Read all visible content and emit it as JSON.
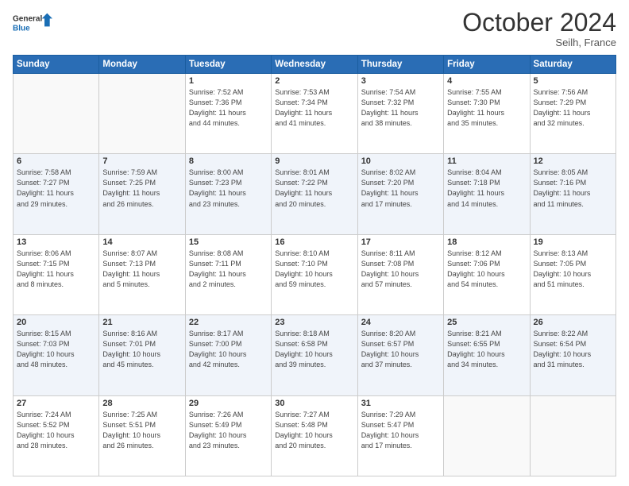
{
  "logo": {
    "line1": "General",
    "line2": "Blue"
  },
  "title": "October 2024",
  "location": "Seilh, France",
  "days_header": [
    "Sunday",
    "Monday",
    "Tuesday",
    "Wednesday",
    "Thursday",
    "Friday",
    "Saturday"
  ],
  "weeks": [
    [
      {
        "day": "",
        "info": ""
      },
      {
        "day": "",
        "info": ""
      },
      {
        "day": "1",
        "info": "Sunrise: 7:52 AM\nSunset: 7:36 PM\nDaylight: 11 hours\nand 44 minutes."
      },
      {
        "day": "2",
        "info": "Sunrise: 7:53 AM\nSunset: 7:34 PM\nDaylight: 11 hours\nand 41 minutes."
      },
      {
        "day": "3",
        "info": "Sunrise: 7:54 AM\nSunset: 7:32 PM\nDaylight: 11 hours\nand 38 minutes."
      },
      {
        "day": "4",
        "info": "Sunrise: 7:55 AM\nSunset: 7:30 PM\nDaylight: 11 hours\nand 35 minutes."
      },
      {
        "day": "5",
        "info": "Sunrise: 7:56 AM\nSunset: 7:29 PM\nDaylight: 11 hours\nand 32 minutes."
      }
    ],
    [
      {
        "day": "6",
        "info": "Sunrise: 7:58 AM\nSunset: 7:27 PM\nDaylight: 11 hours\nand 29 minutes."
      },
      {
        "day": "7",
        "info": "Sunrise: 7:59 AM\nSunset: 7:25 PM\nDaylight: 11 hours\nand 26 minutes."
      },
      {
        "day": "8",
        "info": "Sunrise: 8:00 AM\nSunset: 7:23 PM\nDaylight: 11 hours\nand 23 minutes."
      },
      {
        "day": "9",
        "info": "Sunrise: 8:01 AM\nSunset: 7:22 PM\nDaylight: 11 hours\nand 20 minutes."
      },
      {
        "day": "10",
        "info": "Sunrise: 8:02 AM\nSunset: 7:20 PM\nDaylight: 11 hours\nand 17 minutes."
      },
      {
        "day": "11",
        "info": "Sunrise: 8:04 AM\nSunset: 7:18 PM\nDaylight: 11 hours\nand 14 minutes."
      },
      {
        "day": "12",
        "info": "Sunrise: 8:05 AM\nSunset: 7:16 PM\nDaylight: 11 hours\nand 11 minutes."
      }
    ],
    [
      {
        "day": "13",
        "info": "Sunrise: 8:06 AM\nSunset: 7:15 PM\nDaylight: 11 hours\nand 8 minutes."
      },
      {
        "day": "14",
        "info": "Sunrise: 8:07 AM\nSunset: 7:13 PM\nDaylight: 11 hours\nand 5 minutes."
      },
      {
        "day": "15",
        "info": "Sunrise: 8:08 AM\nSunset: 7:11 PM\nDaylight: 11 hours\nand 2 minutes."
      },
      {
        "day": "16",
        "info": "Sunrise: 8:10 AM\nSunset: 7:10 PM\nDaylight: 10 hours\nand 59 minutes."
      },
      {
        "day": "17",
        "info": "Sunrise: 8:11 AM\nSunset: 7:08 PM\nDaylight: 10 hours\nand 57 minutes."
      },
      {
        "day": "18",
        "info": "Sunrise: 8:12 AM\nSunset: 7:06 PM\nDaylight: 10 hours\nand 54 minutes."
      },
      {
        "day": "19",
        "info": "Sunrise: 8:13 AM\nSunset: 7:05 PM\nDaylight: 10 hours\nand 51 minutes."
      }
    ],
    [
      {
        "day": "20",
        "info": "Sunrise: 8:15 AM\nSunset: 7:03 PM\nDaylight: 10 hours\nand 48 minutes."
      },
      {
        "day": "21",
        "info": "Sunrise: 8:16 AM\nSunset: 7:01 PM\nDaylight: 10 hours\nand 45 minutes."
      },
      {
        "day": "22",
        "info": "Sunrise: 8:17 AM\nSunset: 7:00 PM\nDaylight: 10 hours\nand 42 minutes."
      },
      {
        "day": "23",
        "info": "Sunrise: 8:18 AM\nSunset: 6:58 PM\nDaylight: 10 hours\nand 39 minutes."
      },
      {
        "day": "24",
        "info": "Sunrise: 8:20 AM\nSunset: 6:57 PM\nDaylight: 10 hours\nand 37 minutes."
      },
      {
        "day": "25",
        "info": "Sunrise: 8:21 AM\nSunset: 6:55 PM\nDaylight: 10 hours\nand 34 minutes."
      },
      {
        "day": "26",
        "info": "Sunrise: 8:22 AM\nSunset: 6:54 PM\nDaylight: 10 hours\nand 31 minutes."
      }
    ],
    [
      {
        "day": "27",
        "info": "Sunrise: 7:24 AM\nSunset: 5:52 PM\nDaylight: 10 hours\nand 28 minutes."
      },
      {
        "day": "28",
        "info": "Sunrise: 7:25 AM\nSunset: 5:51 PM\nDaylight: 10 hours\nand 26 minutes."
      },
      {
        "day": "29",
        "info": "Sunrise: 7:26 AM\nSunset: 5:49 PM\nDaylight: 10 hours\nand 23 minutes."
      },
      {
        "day": "30",
        "info": "Sunrise: 7:27 AM\nSunset: 5:48 PM\nDaylight: 10 hours\nand 20 minutes."
      },
      {
        "day": "31",
        "info": "Sunrise: 7:29 AM\nSunset: 5:47 PM\nDaylight: 10 hours\nand 17 minutes."
      },
      {
        "day": "",
        "info": ""
      },
      {
        "day": "",
        "info": ""
      }
    ]
  ]
}
